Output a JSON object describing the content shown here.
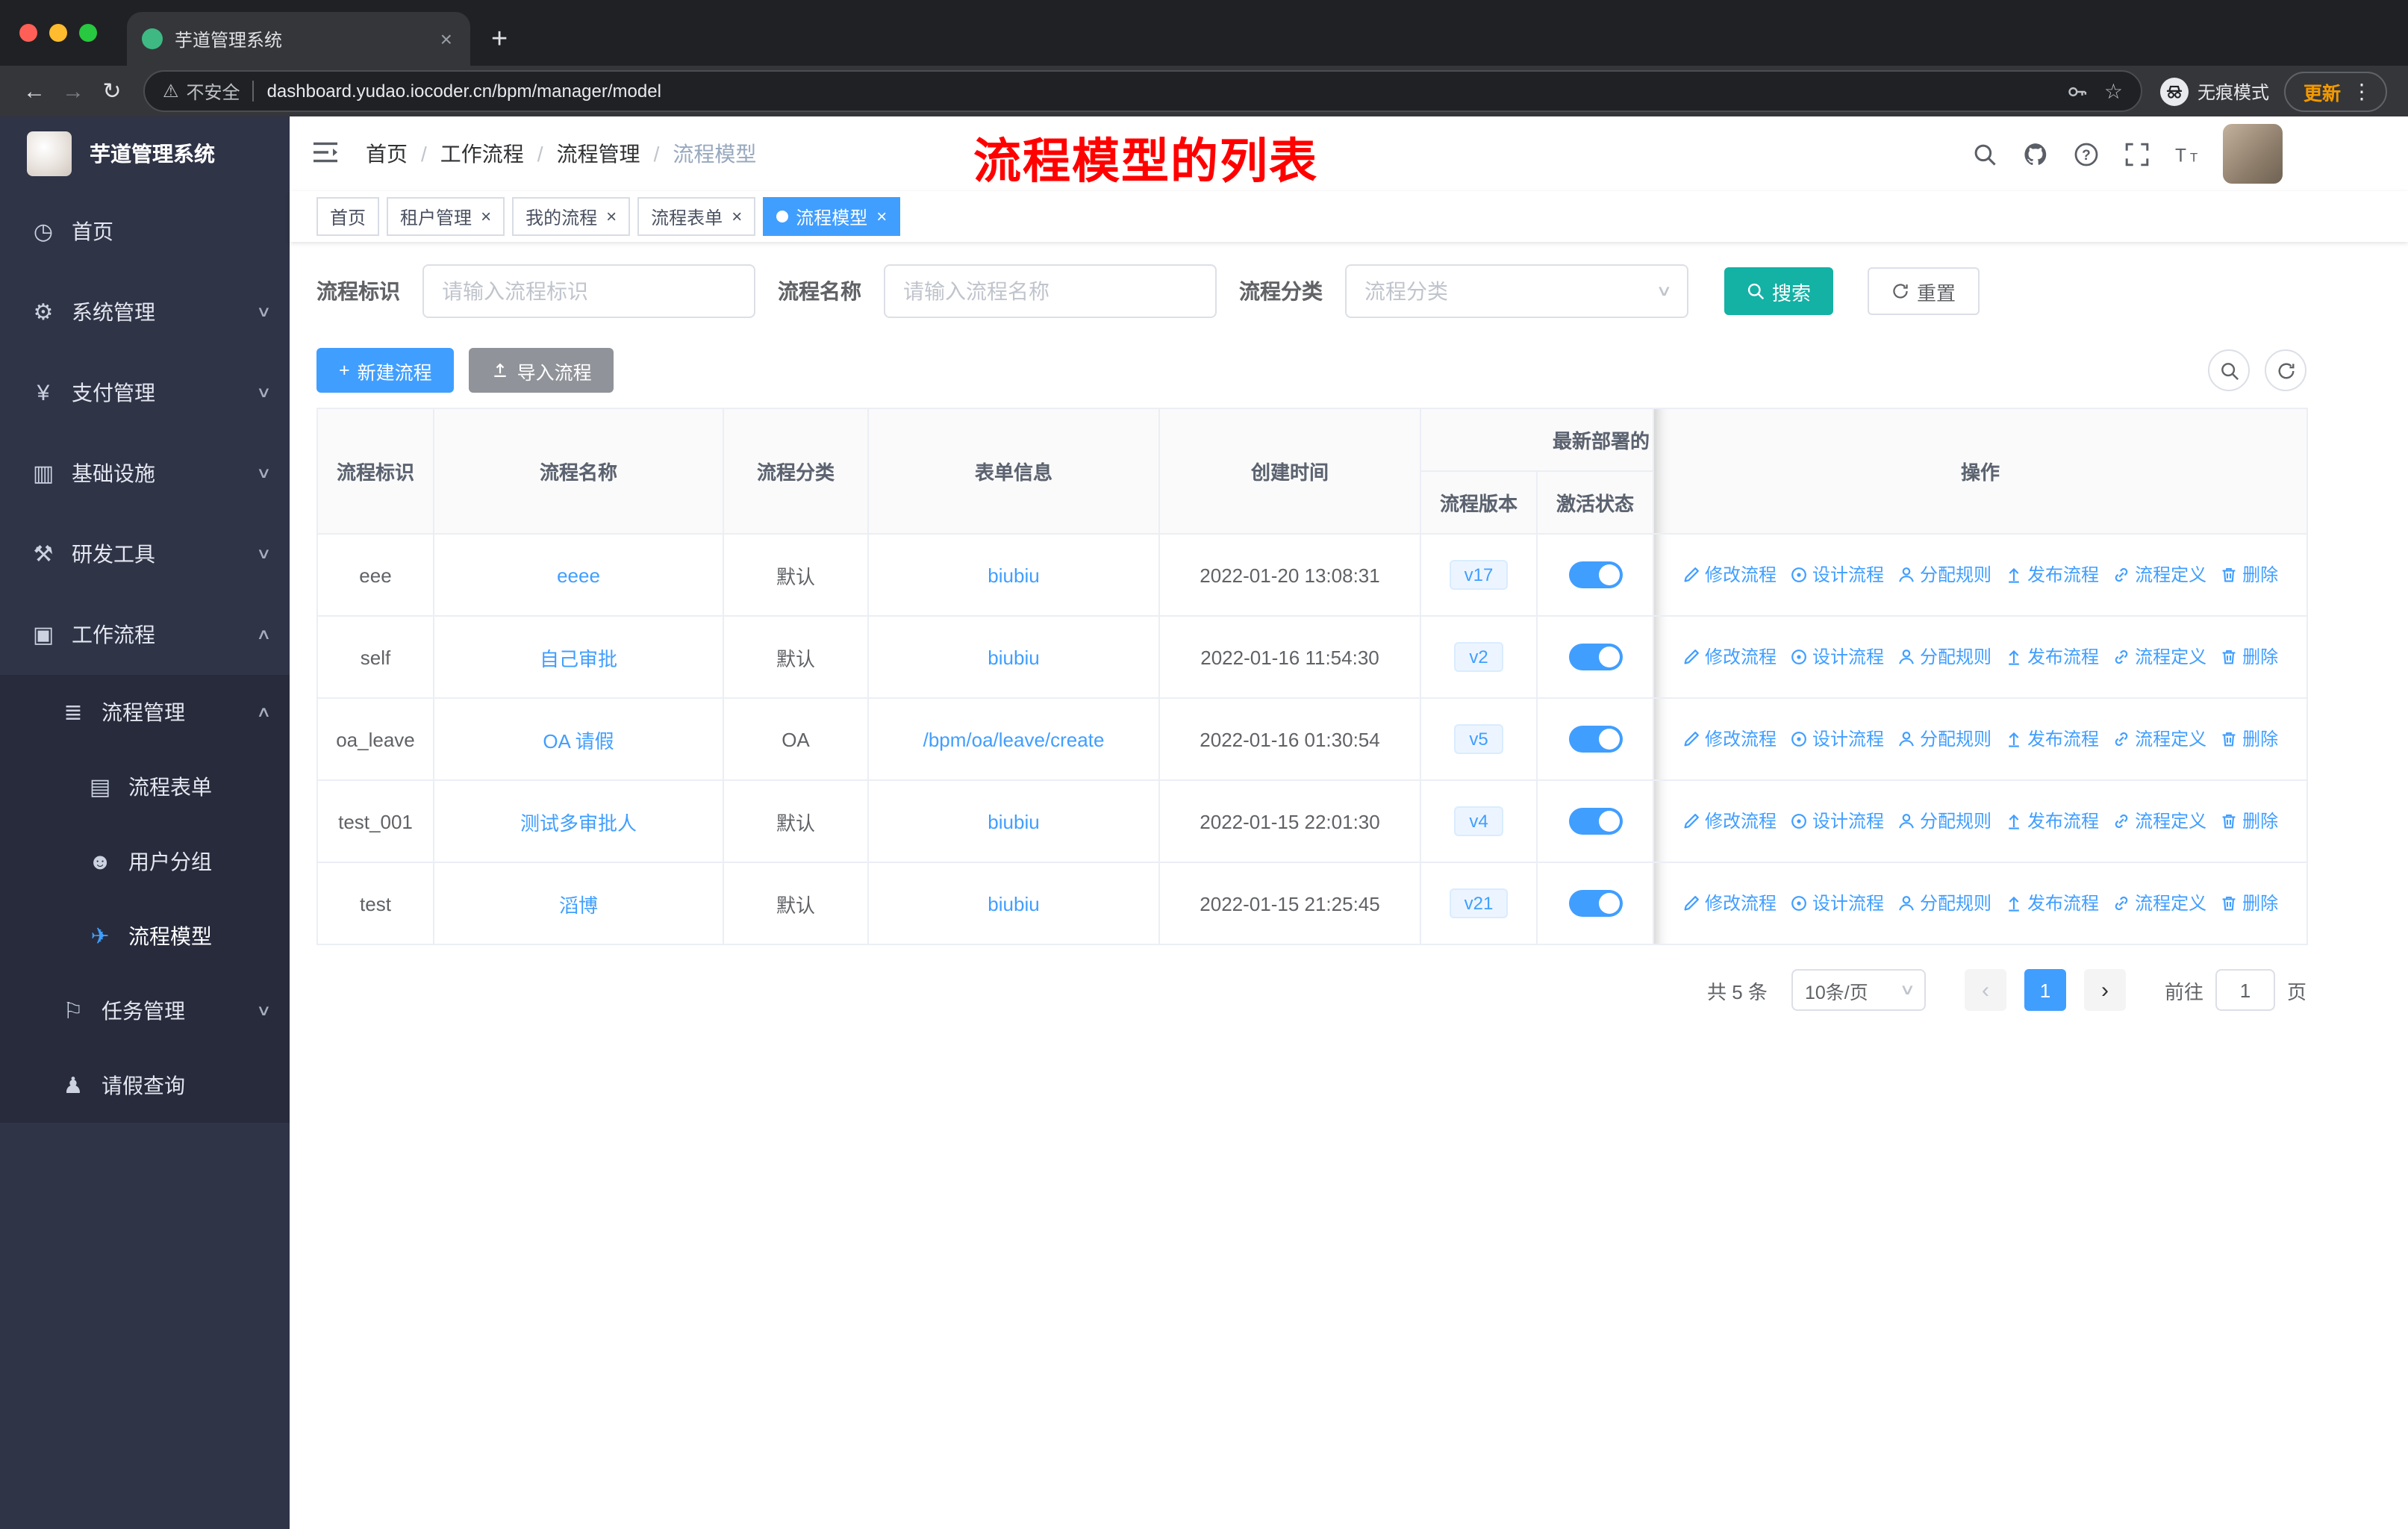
{
  "colors": {
    "primary": "#409eff",
    "search": "#14b1a5",
    "annotation": "#ff0000"
  },
  "browser": {
    "tab": {
      "title": "芋道管理系统",
      "favicon": "plant-favicon"
    },
    "address": {
      "security": "不安全",
      "url": "dashboard.yudao.iocoder.cn/bpm/manager/model"
    },
    "incognito": "无痕模式",
    "update": "更新"
  },
  "sidebar": {
    "logo": "芋道管理系统",
    "menu": [
      {
        "key": "home",
        "label": "首页",
        "icon": "dashboard-icon",
        "glyph": "◷",
        "level": 1
      },
      {
        "key": "system",
        "label": "系统管理",
        "icon": "gear-icon",
        "glyph": "⚙",
        "level": 1,
        "arrow": "down"
      },
      {
        "key": "payment",
        "label": "支付管理",
        "icon": "yen-icon",
        "glyph": "¥",
        "level": 1,
        "arrow": "down"
      },
      {
        "key": "infra",
        "label": "基础设施",
        "icon": "infrastructure-icon",
        "glyph": "▥",
        "level": 1,
        "arrow": "down"
      },
      {
        "key": "devtools",
        "label": "研发工具",
        "icon": "tools-icon",
        "glyph": "⚒",
        "level": 1,
        "arrow": "down"
      },
      {
        "key": "workflow",
        "label": "工作流程",
        "icon": "workflow-icon",
        "glyph": "▣",
        "level": 1,
        "arrow": "up"
      },
      {
        "key": "process-mgmt",
        "label": "流程管理",
        "icon": "process-list-icon",
        "glyph": "≣",
        "level": 2,
        "arrow": "up",
        "sub": true
      },
      {
        "key": "process-form",
        "label": "流程表单",
        "icon": "form-icon",
        "glyph": "▤",
        "level": 3,
        "sub": true
      },
      {
        "key": "user-group",
        "label": "用户分组",
        "icon": "user-group-icon",
        "glyph": "☻",
        "level": 3,
        "sub": true
      },
      {
        "key": "process-model",
        "label": "流程模型",
        "icon": "paper-plane-icon",
        "glyph": "✈",
        "level": 3,
        "sub": true,
        "active": true
      },
      {
        "key": "task-mgmt",
        "label": "任务管理",
        "icon": "task-flag-icon",
        "glyph": "⚐",
        "level": 2,
        "arrow": "down",
        "sub": true
      },
      {
        "key": "leave-query",
        "label": "请假查询",
        "icon": "person-icon",
        "glyph": "♟",
        "level": 2,
        "sub": true
      }
    ]
  },
  "navbar": {
    "breadcrumb": [
      "首页",
      "工作流程",
      "流程管理",
      "流程模型"
    ],
    "annotation": "流程模型的列表"
  },
  "tags": [
    {
      "label": "首页",
      "closable": false,
      "active": false
    },
    {
      "label": "租户管理",
      "closable": true,
      "active": false
    },
    {
      "label": "我的流程",
      "closable": true,
      "active": false
    },
    {
      "label": "流程表单",
      "closable": true,
      "active": false
    },
    {
      "label": "流程模型",
      "closable": true,
      "active": true
    }
  ],
  "filters": {
    "id_label": "流程标识",
    "id_placeholder": "请输入流程标识",
    "name_label": "流程名称",
    "name_placeholder": "请输入流程名称",
    "category_label": "流程分类",
    "category_placeholder": "流程分类",
    "search": "搜索",
    "reset": "重置"
  },
  "toolbar": {
    "create": "新建流程",
    "create_plus": "+",
    "import": "导入流程"
  },
  "table": {
    "columns": [
      "流程标识",
      "流程名称",
      "流程分类",
      "表单信息",
      "创建时间"
    ],
    "group_header": "最新部署的",
    "sub_columns": [
      "流程版本",
      "激活状态"
    ],
    "ops_header": "操作",
    "actions": [
      {
        "name": "edit-process-link",
        "label": "修改流程",
        "icon": "edit-icon"
      },
      {
        "name": "design-process-link",
        "label": "设计流程",
        "icon": "design-icon"
      },
      {
        "name": "assign-rule-link",
        "label": "分配规则",
        "icon": "assign-icon"
      },
      {
        "name": "publish-process-link",
        "label": "发布流程",
        "icon": "publish-icon"
      },
      {
        "name": "process-definition-link",
        "label": "流程定义",
        "icon": "definition-icon"
      },
      {
        "name": "delete-link",
        "label": "删除",
        "icon": "delete-icon"
      }
    ],
    "rows": [
      {
        "id": "eee",
        "name": "eeee",
        "category": "默认",
        "form": "biubiu",
        "created": "2022-01-20 13:08:31",
        "version": "v17",
        "active": true
      },
      {
        "id": "self",
        "name": "自己审批",
        "category": "默认",
        "form": "biubiu",
        "created": "2022-01-16 11:54:30",
        "version": "v2",
        "active": true
      },
      {
        "id": "oa_leave",
        "name": "OA 请假",
        "category": "OA",
        "form": "/bpm/oa/leave/create",
        "created": "2022-01-16 01:30:54",
        "version": "v5",
        "active": true
      },
      {
        "id": "test_001",
        "name": "测试多审批人",
        "category": "默认",
        "form": "biubiu",
        "created": "2022-01-15 22:01:30",
        "version": "v4",
        "active": true
      },
      {
        "id": "test",
        "name": "滔博",
        "category": "默认",
        "form": "biubiu",
        "created": "2022-01-15 21:25:45",
        "version": "v21",
        "active": true
      }
    ]
  },
  "pagination": {
    "total": "共 5 条",
    "size": "10条/页",
    "prev": "‹",
    "next": "›",
    "page": "1",
    "goto": "前往",
    "unit": "页"
  }
}
